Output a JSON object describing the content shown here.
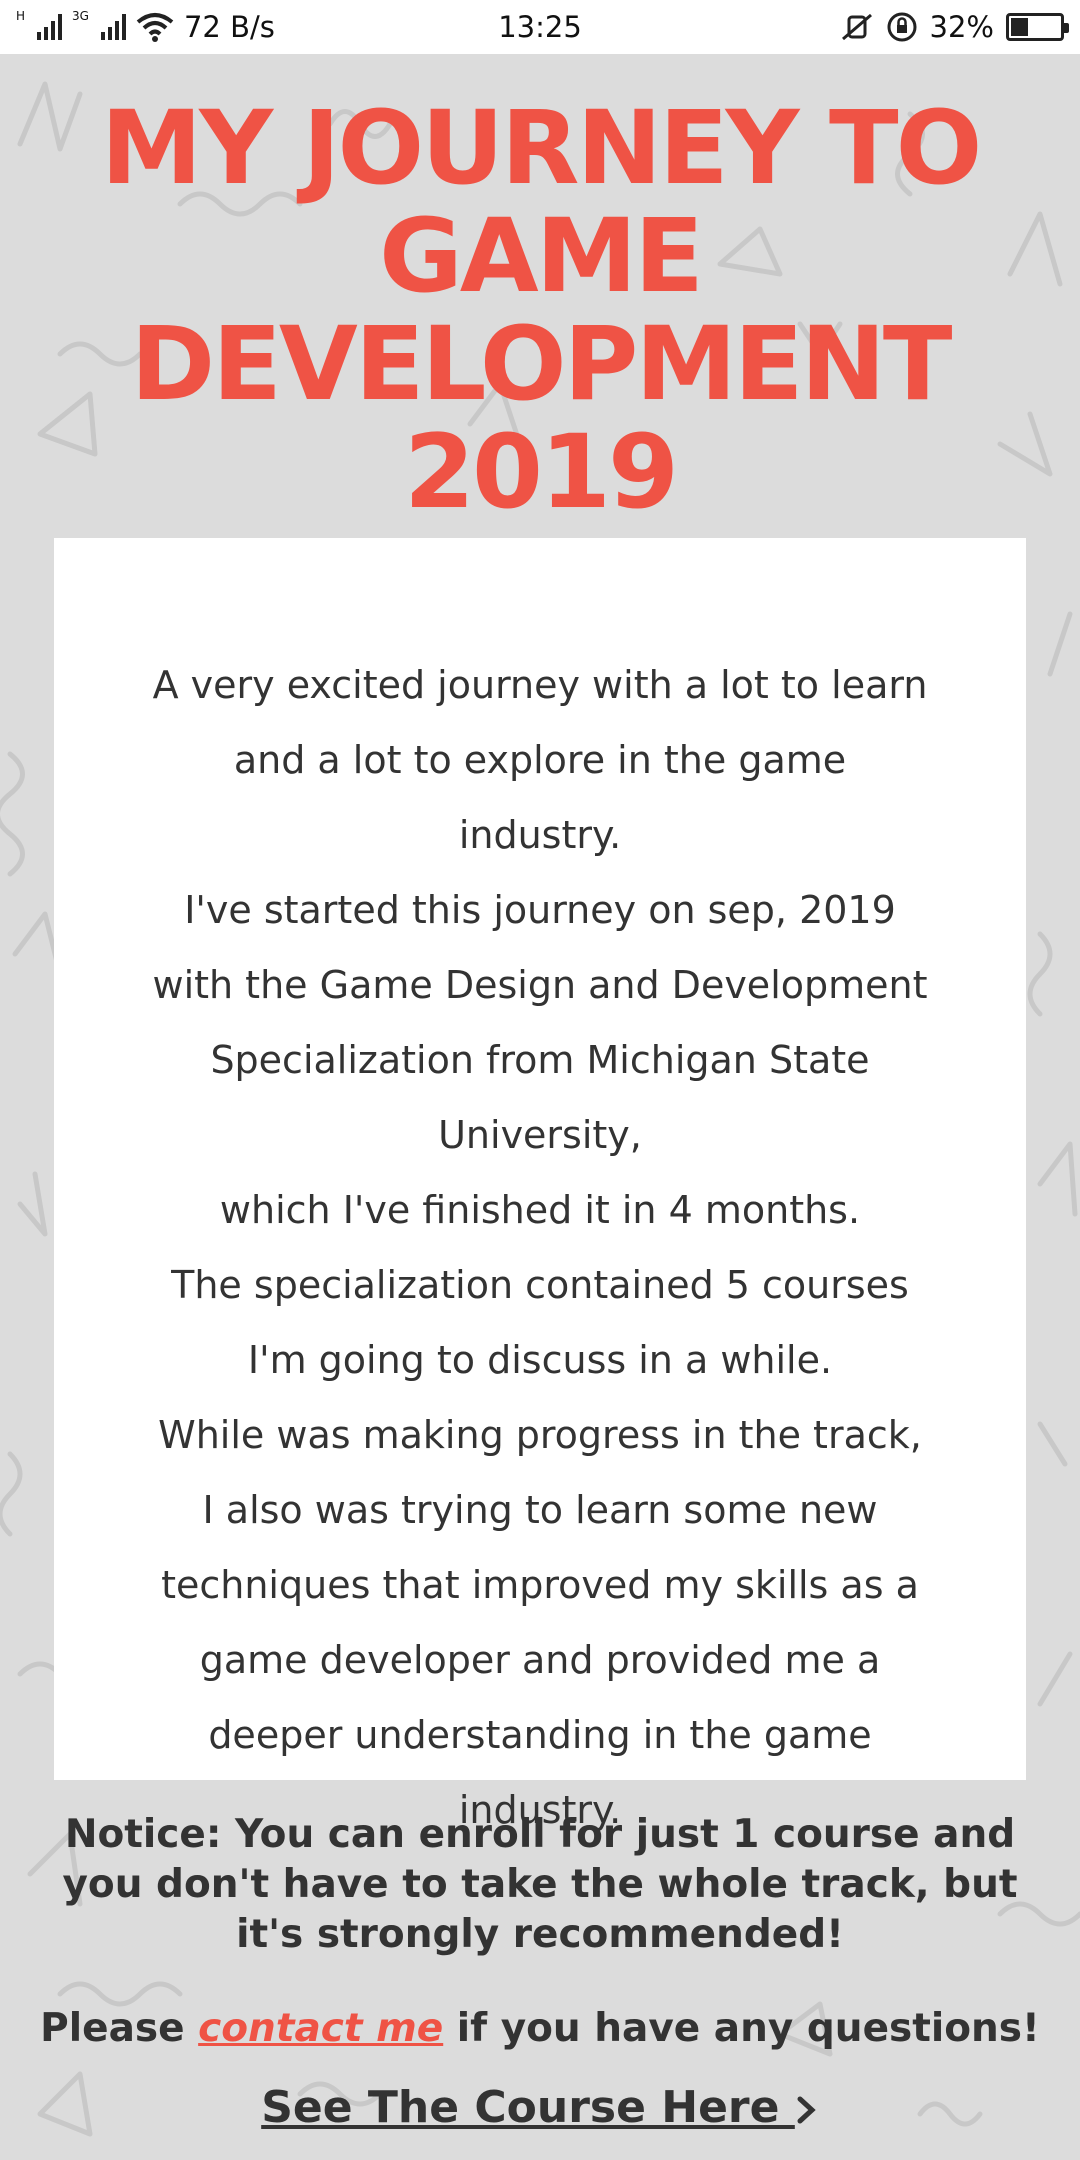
{
  "status_bar": {
    "network_speed": "72 B/s",
    "time": "13:25",
    "battery": "32%",
    "signal_tag_1": "H",
    "signal_tag_2": "3G"
  },
  "page": {
    "title": "MY JOURNEY TO GAME DEVELOPMENT 2019",
    "intro_paragraphs": [
      "A very excited journey with a lot to learn and a lot to explore in the game industry.",
      "I've started this journey on sep, 2019 with the Game Design and Development Specialization from Michigan State University,",
      "which I've finished it in 4 months.",
      "The specialization contained 5 courses I'm going to discuss in a while.",
      "While was making progress in the track, I also was trying to learn some new techniques that improved my skills as a game developer and provided me a deeper understanding in the game industry."
    ],
    "notice": "Notice: You can enroll for just 1 course and you don't have to take the whole track, but it's strongly recommended!",
    "contact_prefix": "Please",
    "contact_link": "contact me",
    "contact_suffix": "if you have any questions!",
    "course_link": "See The Course Here",
    "course_icon": "chevron-right-icon"
  },
  "colors": {
    "accent": "#ef5345",
    "background": "#dcdcdc",
    "card": "#ffffff",
    "text": "#333333"
  }
}
